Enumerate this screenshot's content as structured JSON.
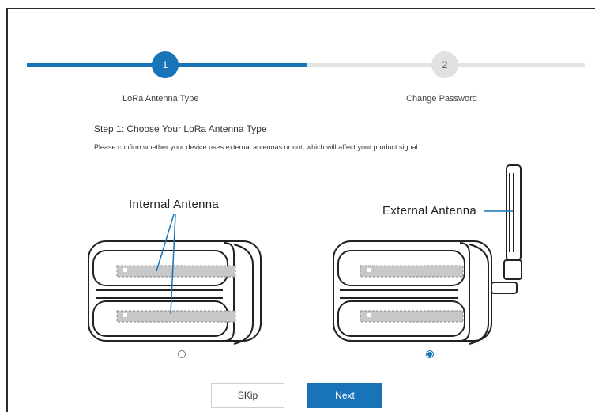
{
  "stepper": {
    "steps": [
      {
        "number": "1",
        "label": "LoRa Antenna Type",
        "active": true
      },
      {
        "number": "2",
        "label": "Change Password",
        "active": false
      }
    ],
    "progress_fraction": 0.5,
    "colors": {
      "active": "#1873b8",
      "inactive": "#e1e1e1"
    }
  },
  "content": {
    "title": "Step 1: Choose Your LoRa Antenna Type",
    "description": "Please confirm whether your device uses external antennas or not, which will affect your product signal."
  },
  "options": [
    {
      "label": "Internal Antenna",
      "selected": false
    },
    {
      "label": "External Antenna",
      "selected": true
    }
  ],
  "buttons": {
    "skip_label": "SKip",
    "next_label": "Next"
  }
}
